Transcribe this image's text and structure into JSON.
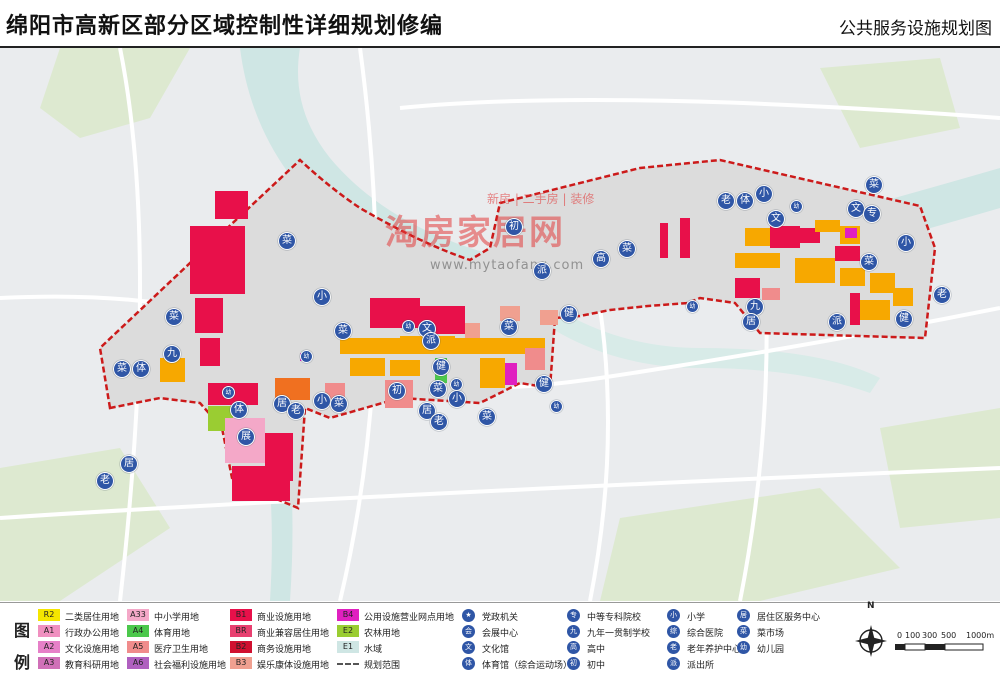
{
  "header": {
    "title": "绵阳市高新区部分区域控制性详细规划修编",
    "subtitle": "公共服务设施规划图"
  },
  "watermark": {
    "brand": "淘房家居网",
    "tagline": "新房 | 二手房 | 装修",
    "url": "www.mytaofang.com"
  },
  "colors": {
    "commercial": "#e8104a",
    "business": "#f7a800",
    "medical": "#f08c8c",
    "sports": "#4cc84c",
    "edu": "#f0a8c8",
    "water": "#cfe6e4",
    "boundary": "#cc1a1a",
    "icon": "#2f56a6"
  },
  "map_labels": {
    "cai": "菜",
    "xiao": "小",
    "jiu": "九",
    "ti": "体",
    "zhan": "展",
    "ju": "居",
    "lao": "老",
    "wen": "文",
    "pai": "派",
    "jian": "健",
    "chu": "初",
    "gao": "高",
    "zhuan": "专",
    "you": "幼"
  },
  "legend": {
    "title_top": "图",
    "title_bottom": "例",
    "land": [
      {
        "code": "R2",
        "label": "二类居住用地",
        "color": "#f5e600"
      },
      {
        "code": "A1",
        "label": "行政办公用地",
        "color": "#f090c0"
      },
      {
        "code": "A2",
        "label": "文化设施用地",
        "color": "#e680c8"
      },
      {
        "code": "A3",
        "label": "教育科研用地",
        "color": "#d070b8"
      },
      {
        "code": "A33",
        "label": "中小学用地",
        "color": "#f4a8c8"
      },
      {
        "code": "A4",
        "label": "体育用地",
        "color": "#4cc84c"
      },
      {
        "code": "A5",
        "label": "医疗卫生用地",
        "color": "#f08c8c"
      },
      {
        "code": "A6",
        "label": "社会福利设施用地",
        "color": "#b060c0"
      },
      {
        "code": "B1",
        "label": "商业设施用地",
        "color": "#e8104a"
      },
      {
        "code": "BR",
        "label": "商业兼容居住用地",
        "color": "#e84070"
      },
      {
        "code": "B2",
        "label": "商务设施用地",
        "color": "#d01030"
      },
      {
        "code": "B3",
        "label": "娱乐康体设施用地",
        "color": "#f0a090"
      },
      {
        "code": "B4",
        "label": "公用设施营业网点用地",
        "color": "#e020c0"
      },
      {
        "code": "E2",
        "label": "农林用地",
        "color": "#9acd32"
      },
      {
        "code": "E1",
        "label": "水域",
        "color": "#cfe6e4"
      },
      {
        "code": "",
        "label": "规划范围",
        "color": "#555555"
      }
    ],
    "icons": [
      {
        "glyph": "★",
        "label": "党政机关"
      },
      {
        "glyph": "会",
        "label": "会展中心"
      },
      {
        "glyph": "文",
        "label": "文化馆"
      },
      {
        "glyph": "体",
        "label": "体育馆（综合运动场）"
      },
      {
        "glyph": "专",
        "label": "中等专科院校"
      },
      {
        "glyph": "九",
        "label": "九年一贯制学校"
      },
      {
        "glyph": "高",
        "label": "高中"
      },
      {
        "glyph": "初",
        "label": "初中"
      },
      {
        "glyph": "小",
        "label": "小学"
      },
      {
        "glyph": "综",
        "label": "综合医院"
      },
      {
        "glyph": "老",
        "label": "老年养护中心"
      },
      {
        "glyph": "派",
        "label": "派出所"
      },
      {
        "glyph": "居",
        "label": "居住区服务中心"
      },
      {
        "glyph": "菜",
        "label": "菜市场"
      },
      {
        "glyph": "幼",
        "label": "幼儿园"
      }
    ],
    "north": "N",
    "scale": [
      "0",
      "100",
      "300",
      "500",
      "1000m"
    ]
  }
}
